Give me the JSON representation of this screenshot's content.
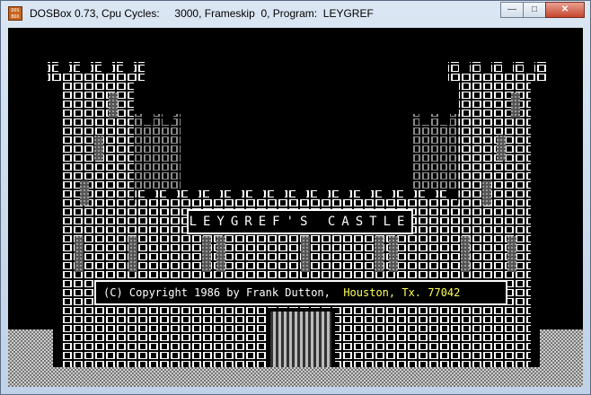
{
  "window": {
    "title": "DOSBox 0.73, Cpu Cycles:     3000, Frameskip  0, Program:  LEYGREF",
    "icon_text": "DOS BOX",
    "controls": {
      "minimize": "—",
      "maximize": "□",
      "close": "✕"
    }
  },
  "game": {
    "title_banner": "LEYGREF'S CASTLE",
    "copyright": "(C) Copyright 1986 by Frank Dutton,",
    "location": "Houston, Tx. 77042",
    "colors": {
      "background": "#000000",
      "brick": "#ffffff",
      "location_text": "#ffff55",
      "ground": "#aaaaaa",
      "side_towers": "#8a8a8a"
    }
  }
}
